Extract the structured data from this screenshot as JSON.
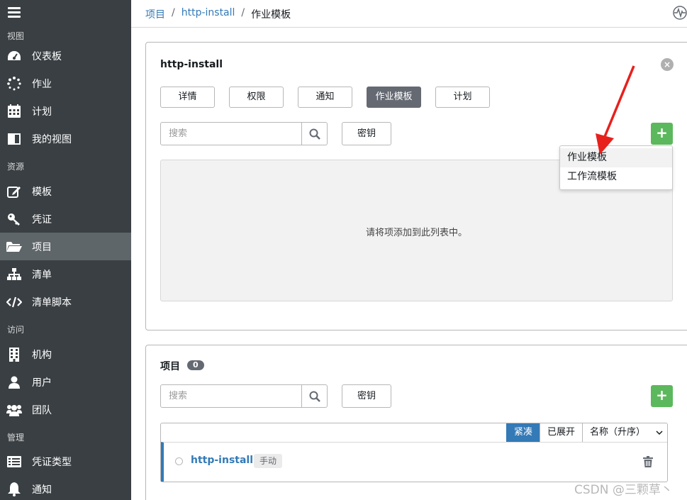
{
  "sidebar": {
    "sections": [
      {
        "label": "视图"
      },
      {
        "label": "资源"
      },
      {
        "label": "访问"
      },
      {
        "label": "管理"
      }
    ],
    "items": [
      {
        "label": "仪表板",
        "icon": "tachometer-icon"
      },
      {
        "label": "作业",
        "icon": "spinner-icon"
      },
      {
        "label": "计划",
        "icon": "calendar-icon"
      },
      {
        "label": "我的视图",
        "icon": "columns-icon"
      },
      {
        "label": "模板",
        "icon": "edit-icon"
      },
      {
        "label": "凭证",
        "icon": "key-icon"
      },
      {
        "label": "项目",
        "icon": "folder-open-icon"
      },
      {
        "label": "清单",
        "icon": "sitemap-icon"
      },
      {
        "label": "清单脚本",
        "icon": "code-icon"
      },
      {
        "label": "机构",
        "icon": "building-icon"
      },
      {
        "label": "用户",
        "icon": "user-icon"
      },
      {
        "label": "团队",
        "icon": "users-icon"
      },
      {
        "label": "凭证类型",
        "icon": "list-alt-icon"
      },
      {
        "label": "通知",
        "icon": "bell-icon"
      }
    ],
    "active_item": "项目"
  },
  "breadcrumb": {
    "items": [
      "项目",
      "http-install",
      "作业模板"
    ],
    "separator": "/"
  },
  "panel1": {
    "title": "http-install",
    "tabs": [
      {
        "label": "详情"
      },
      {
        "label": "权限"
      },
      {
        "label": "通知"
      },
      {
        "label": "作业模板"
      },
      {
        "label": "计划"
      }
    ],
    "active_tab": "作业模板",
    "search_placeholder": "搜索",
    "key_button": "密钥",
    "add_button": "+",
    "empty_text": "请将项添加到此列表中。",
    "dropdown": [
      "作业模板",
      "工作流模板"
    ]
  },
  "panel2": {
    "title": "项目",
    "count": "0",
    "search_placeholder": "搜索",
    "key_button": "密钥",
    "add_button": "+",
    "toolbar": {
      "compact": "紧凑",
      "expanded": "已展开",
      "sort": "名称（升序）"
    },
    "rows": [
      {
        "name": "http-install",
        "tag": "手动"
      }
    ]
  },
  "watermark": "CSDN @三颗草丶",
  "colors": {
    "sidebar_bg": "#393f43",
    "sidebar_active": "#5f6669",
    "link": "#337ab7",
    "add_green": "#5cb85c",
    "arrow_red": "#e8201c"
  }
}
